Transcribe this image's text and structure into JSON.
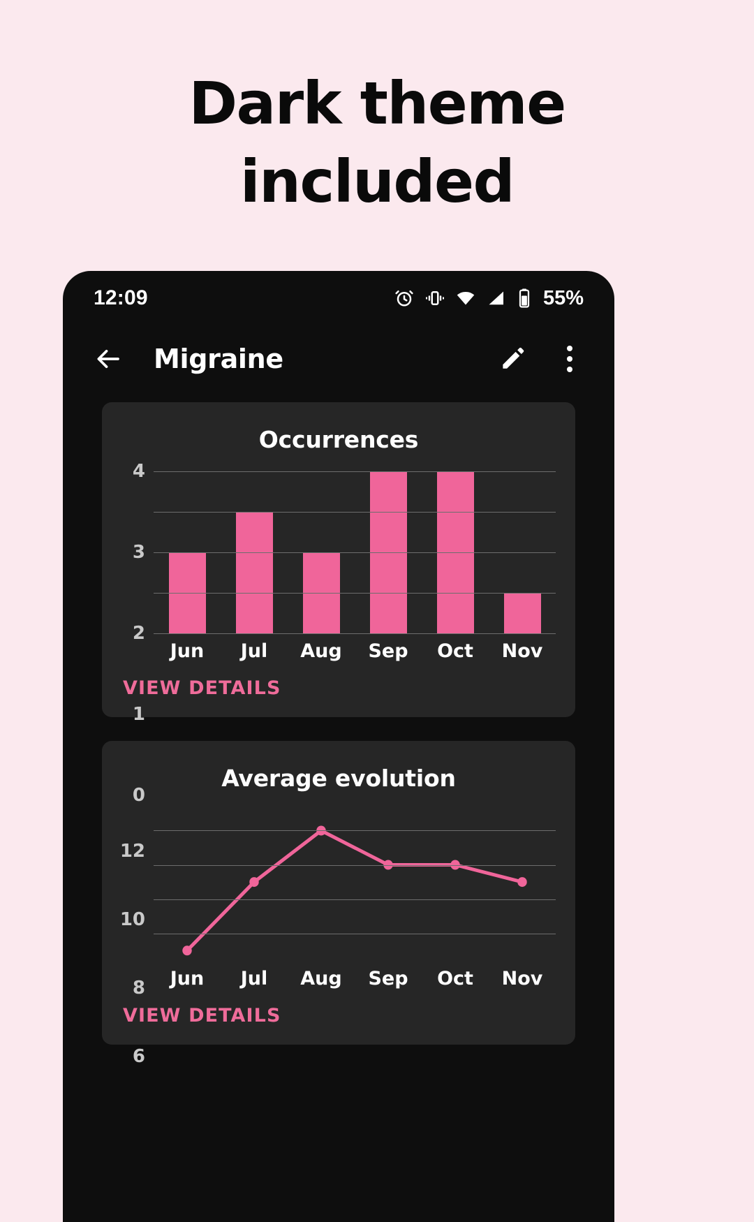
{
  "headline": {
    "line1": "Dark theme",
    "line2": "included"
  },
  "theme": {
    "page_bg": "#fbe9ee",
    "phone_bg": "#0e0e0e",
    "card_bg": "#262626",
    "accent": "#f0659a",
    "link": "#ef6c9a",
    "text": "#ffffff",
    "grid": "#6d6d6d"
  },
  "statusbar": {
    "time": "12:09",
    "battery_percent": "55%",
    "icons": [
      "alarm-icon",
      "vibrate-icon",
      "wifi-icon",
      "signal-icon",
      "battery-icon"
    ]
  },
  "appbar": {
    "back_icon": "back-arrow-icon",
    "title": "Migraine",
    "edit_icon": "pencil-icon",
    "overflow_icon": "more-vert-icon"
  },
  "cards": [
    {
      "title": "Occurrences",
      "view_details_label": "VIEW DETAILS"
    },
    {
      "title": "Average evolution",
      "view_details_label": "VIEW DETAILS"
    }
  ],
  "chart_data": [
    {
      "type": "bar",
      "title": "Occurrences",
      "categories": [
        "Jun",
        "Jul",
        "Aug",
        "Sep",
        "Oct",
        "Nov"
      ],
      "values": [
        2,
        3,
        2,
        4,
        4,
        1
      ],
      "yticks": [
        0,
        1,
        2,
        3,
        4
      ],
      "ylim": [
        0,
        4
      ],
      "xlabel": "",
      "ylabel": "",
      "grid": true,
      "legend": "none",
      "color": "#f0659a"
    },
    {
      "type": "line",
      "title": "Average evolution",
      "categories": [
        "Jun",
        "Jul",
        "Aug",
        "Sep",
        "Oct",
        "Nov"
      ],
      "values": [
        5,
        9,
        12,
        10,
        10,
        9
      ],
      "yticks": [
        6,
        8,
        10,
        12
      ],
      "ylim": [
        4.4,
        13.2
      ],
      "xlabel": "",
      "ylabel": "",
      "grid": true,
      "legend": "none",
      "markers": true,
      "color": "#f0659a"
    }
  ]
}
